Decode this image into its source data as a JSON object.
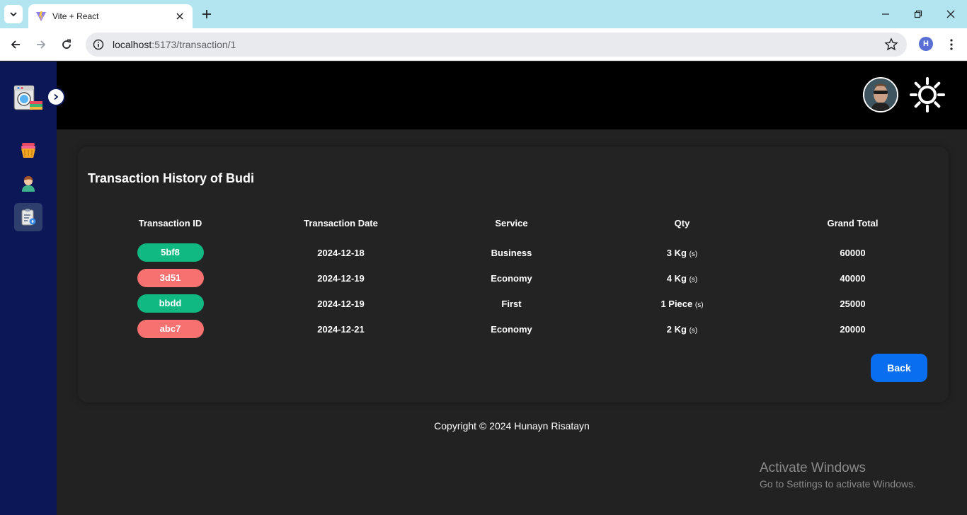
{
  "browser": {
    "tab_title": "Vite + React",
    "url_host": "localhost",
    "url_path": ":5173/transaction/1",
    "profile_initial": "H"
  },
  "page": {
    "title": "Transaction History of Budi",
    "columns": [
      "Transaction ID",
      "Transaction Date",
      "Service",
      "Qty",
      "Grand Total"
    ],
    "rows": [
      {
        "id": "5bf8",
        "id_color": "#10b981",
        "date": "2024-12-18",
        "service": "Business",
        "qty": "3 Kg",
        "unit": "(s)",
        "total": "60000"
      },
      {
        "id": "3d51",
        "id_color": "#f87171",
        "date": "2024-12-19",
        "service": "Economy",
        "qty": "4 Kg",
        "unit": "(s)",
        "total": "40000"
      },
      {
        "id": "bbdd",
        "id_color": "#10b981",
        "date": "2024-12-19",
        "service": "First",
        "qty": "1 Piece",
        "unit": "(s)",
        "total": "25000"
      },
      {
        "id": "abc7",
        "id_color": "#f87171",
        "date": "2024-12-21",
        "service": "Economy",
        "qty": "2 Kg",
        "unit": "(s)",
        "total": "20000"
      }
    ],
    "back_label": "Back",
    "footer": "Copyright © 2024 Hunayn Risatayn"
  },
  "overlay": {
    "activate_title": "Activate Windows",
    "activate_sub": "Go to Settings to activate Windows."
  },
  "colors": {
    "sidebar": "#0b1757",
    "header": "#000000",
    "background": "#222222",
    "accent": "#0a6ef0"
  },
  "icons": {
    "sidebar": [
      "laundry-basket-icon",
      "user-icon",
      "transaction-report-icon"
    ]
  }
}
